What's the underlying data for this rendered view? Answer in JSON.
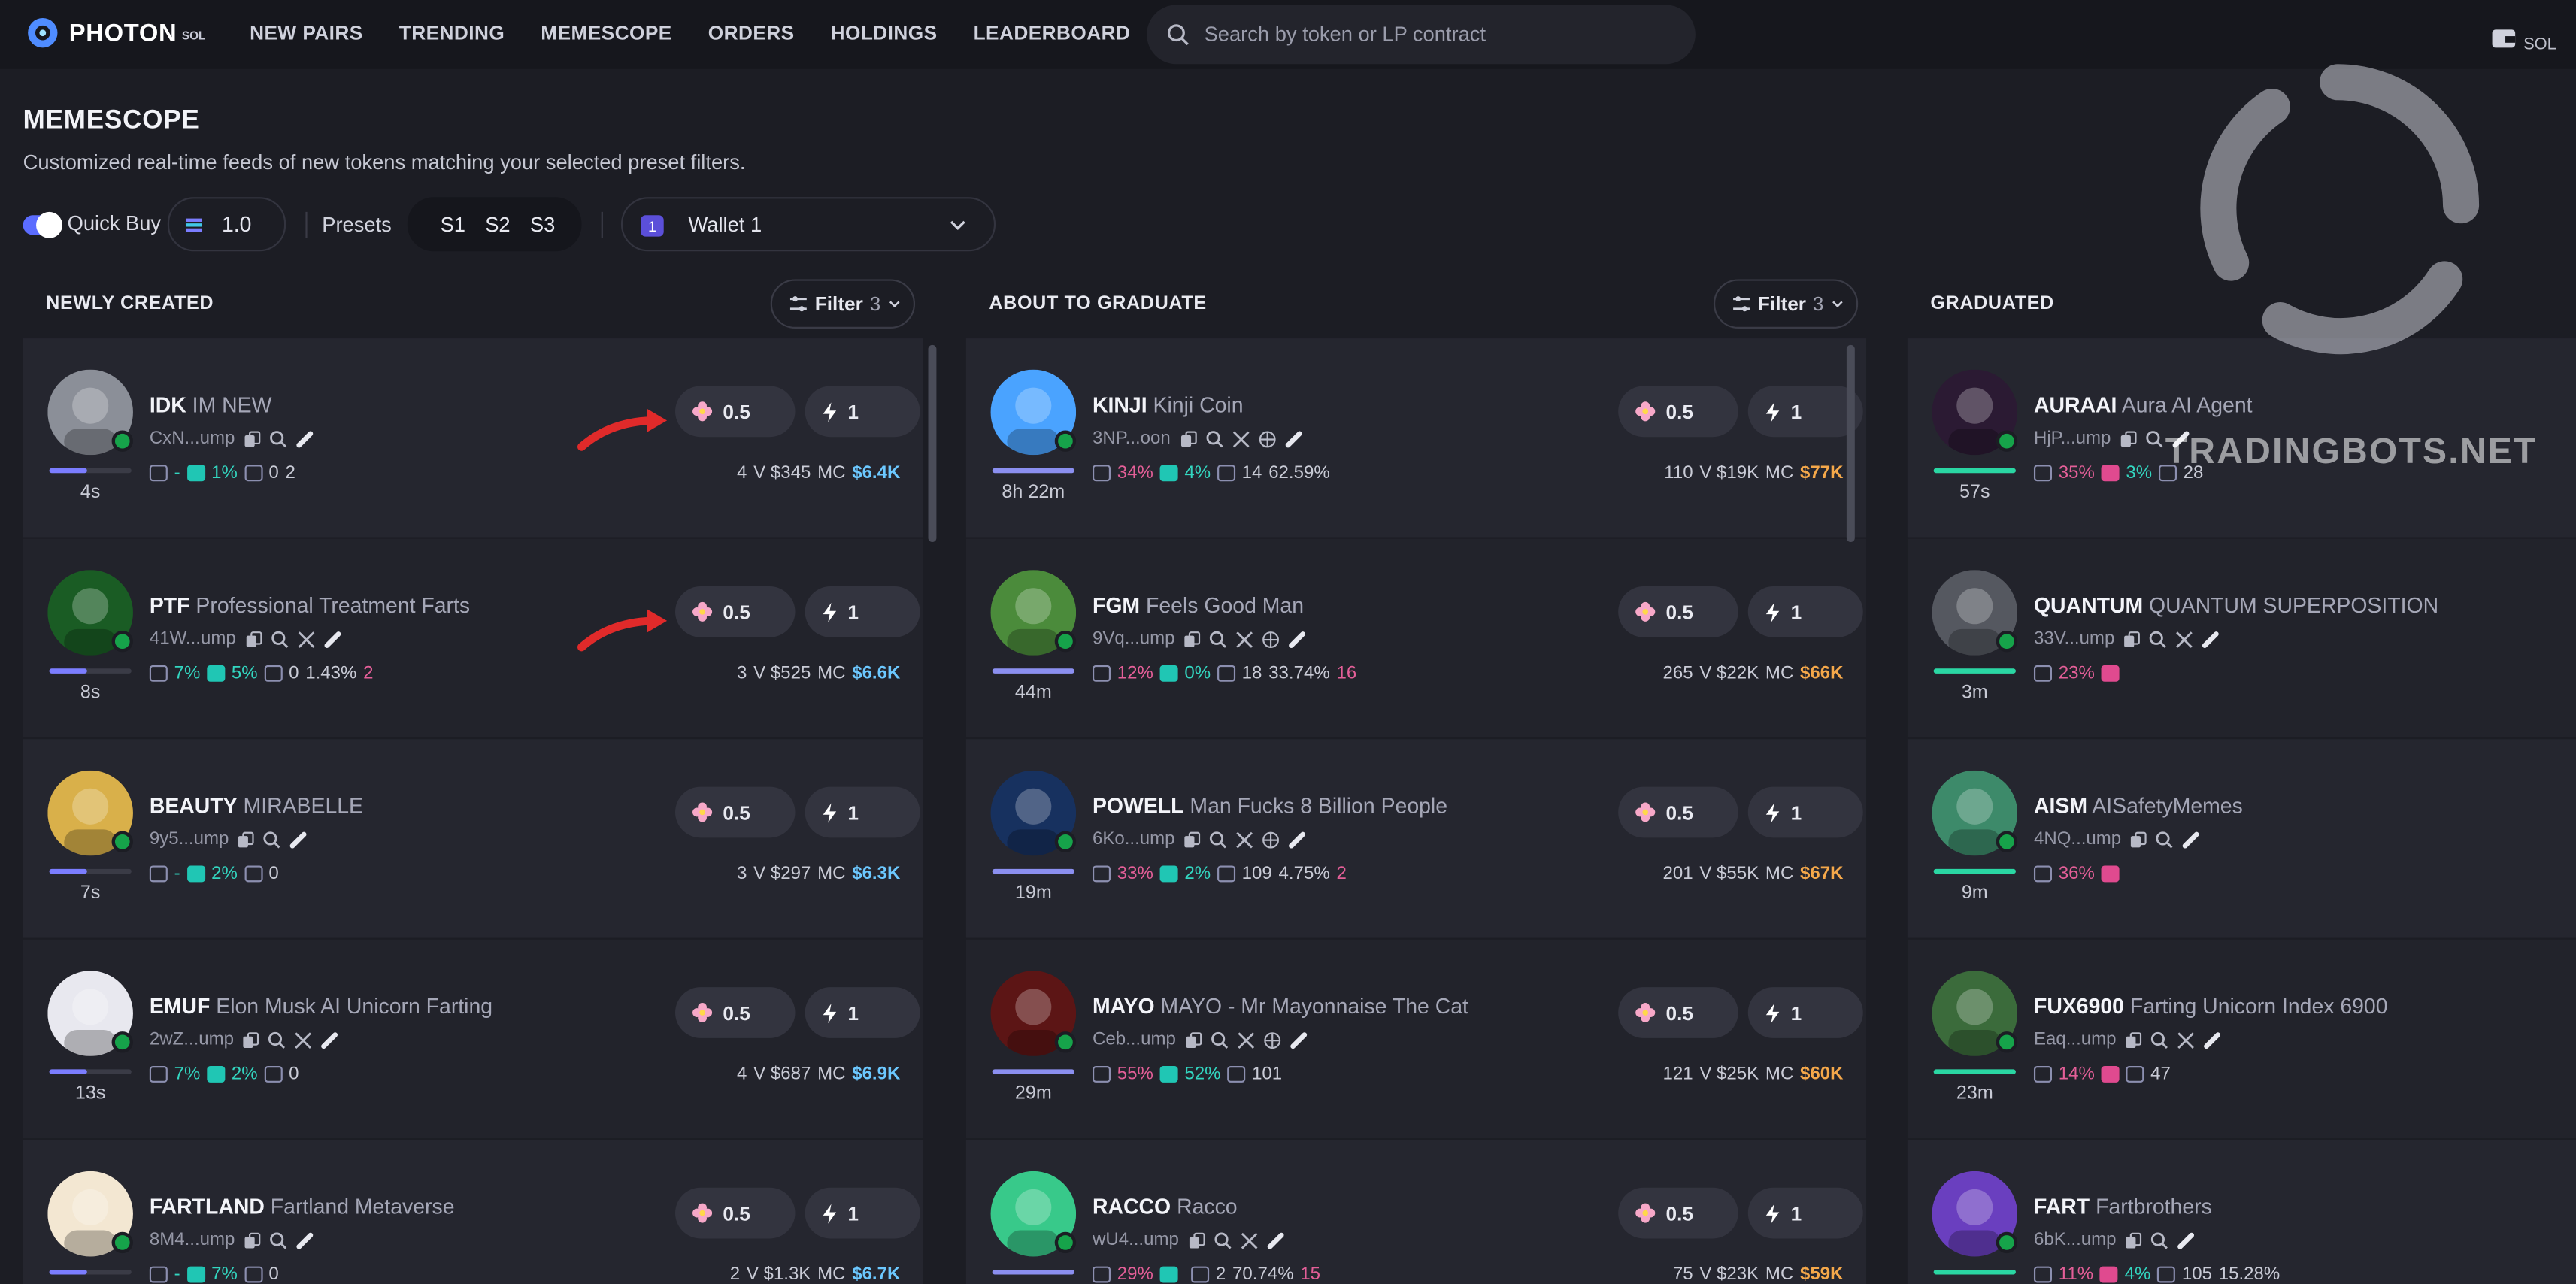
{
  "app": {
    "brand": "PHOTON",
    "brand_sub": "SOL"
  },
  "nav": [
    "NEW PAIRS",
    "TRENDING",
    "MEMESCOPE",
    "ORDERS",
    "HOLDINGS",
    "LEADERBOARD"
  ],
  "search": {
    "placeholder": "Search by token or LP contract"
  },
  "chain": "SOL",
  "header": {
    "title": "MEMESCOPE",
    "subtitle": "Customized real-time feeds of new tokens matching your selected preset filters."
  },
  "controls": {
    "quick_buy_label": "Quick Buy",
    "amount": "1.0",
    "presets_label": "Presets",
    "presets": [
      "S1",
      "S2",
      "S3"
    ],
    "wallet": "Wallet 1",
    "wallet_index": "1"
  },
  "watermark": "TRADINGBOTS.NET",
  "columns": [
    {
      "title": "NEWLY CREATED",
      "filter_label": "Filter",
      "filter_count": "3",
      "cards": [
        {
          "ticker": "IDK",
          "name": "IM NEW",
          "addr": "CxN...ump",
          "age": "4s",
          "progress": 0.45,
          "s1": "-",
          "s2": "1%",
          "s3": "0",
          "s4": "2",
          "holders": "4",
          "vol": "V $345",
          "mc": "$6.4K"
        },
        {
          "ticker": "PTF",
          "name": "Professional Treatment Farts",
          "addr": "41W...ump",
          "age": "8s",
          "progress": 0.45,
          "s1": "7%",
          "s2": "5%",
          "s3": "0",
          "s4": "1.43%",
          "s5": "2",
          "holders": "3",
          "vol": "V $525",
          "mc": "$6.6K"
        },
        {
          "ticker": "BEAUTY",
          "name": "MIRABELLE",
          "addr": "9y5...ump",
          "age": "7s",
          "progress": 0.45,
          "s1": "-",
          "s2": "2%",
          "s3": "0",
          "holders": "3",
          "vol": "V $297",
          "mc": "$6.3K"
        },
        {
          "ticker": "EMUF",
          "name": "Elon Musk AI Unicorn Farting",
          "addr": "2wZ...ump",
          "age": "13s",
          "progress": 0.45,
          "s1": "7%",
          "s2": "2%",
          "s3": "0",
          "holders": "4",
          "vol": "V $687",
          "mc": "$6.9K"
        },
        {
          "ticker": "FARTLAND",
          "name": "Fartland Metaverse",
          "addr": "8M4...ump",
          "age": "",
          "progress": 0.45,
          "s1": "-",
          "s2": "7%",
          "s3": "0",
          "holders": "2",
          "vol": "V $1.3K",
          "mc": "$6.7K"
        }
      ]
    },
    {
      "title": "ABOUT TO GRADUATE",
      "filter_label": "Filter",
      "filter_count": "3",
      "cards": [
        {
          "ticker": "KINJI",
          "name": "Kinji Coin",
          "addr": "3NP...oon",
          "age": "8h 22m",
          "progress": 1,
          "s1": "34%",
          "s2": "4%",
          "s3": "14",
          "s4": "62.59%",
          "holders": "110",
          "vol": "V $19K",
          "mc": "$77K"
        },
        {
          "ticker": "FGM",
          "name": "Feels Good Man",
          "addr": "9Vq...ump",
          "age": "44m",
          "progress": 1,
          "s1": "12%",
          "s2": "0%",
          "s3": "18",
          "s4": "33.74%",
          "s5": "16",
          "holders": "265",
          "vol": "V $22K",
          "mc": "$66K"
        },
        {
          "ticker": "POWELL",
          "name": "Man Fucks 8 Billion People",
          "addr": "6Ko...ump",
          "age": "19m",
          "progress": 1,
          "s1": "33%",
          "s2": "2%",
          "s3": "109",
          "s4": "4.75%",
          "s5": "2",
          "holders": "201",
          "vol": "V $55K",
          "mc": "$67K"
        },
        {
          "ticker": "MAYO",
          "name": "MAYO - Mr Mayonnaise The Cat",
          "addr": "Ceb...ump",
          "age": "29m",
          "progress": 1,
          "s1": "55%",
          "s2": "52%",
          "s3": "101",
          "holders": "121",
          "vol": "V $25K",
          "mc": "$60K"
        },
        {
          "ticker": "RACCO",
          "name": "Racco",
          "addr": "wU4...ump",
          "age": "",
          "progress": 1,
          "s1": "29%",
          "s2": "",
          "s3": "2",
          "s4": "70.74%",
          "s5": "15",
          "holders": "75",
          "vol": "V $23K",
          "mc": "$59K"
        }
      ]
    },
    {
      "title": "GRADUATED",
      "cards": [
        {
          "ticker": "AURAAI",
          "name": "Aura AI Agent",
          "addr": "HjP...ump",
          "age": "57s",
          "progress": 1,
          "s1": "35%",
          "s2": "3%",
          "s3": "28"
        },
        {
          "ticker": "QUANTUM",
          "name": "QUANTUM SUPERPOSITION",
          "addr": "33V...ump",
          "age": "3m",
          "progress": 1,
          "s1": "23%"
        },
        {
          "ticker": "AISM",
          "name": "AISafetyMemes",
          "addr": "4NQ...ump",
          "age": "9m",
          "progress": 1,
          "s1": "36%"
        },
        {
          "ticker": "FUX6900",
          "name": "Farting Unicorn Index 6900",
          "addr": "Eaq...ump",
          "age": "23m",
          "progress": 1,
          "s1": "14%",
          "s3": "47"
        },
        {
          "ticker": "FART",
          "name": "Fartbrothers",
          "addr": "6bK...ump",
          "age": "",
          "progress": 1,
          "s1": "11%",
          "s2": "4%",
          "s3": "105",
          "s4": "15.28%"
        }
      ]
    }
  ],
  "buy": {
    "amount_a": "0.5",
    "amount_b": "1"
  }
}
